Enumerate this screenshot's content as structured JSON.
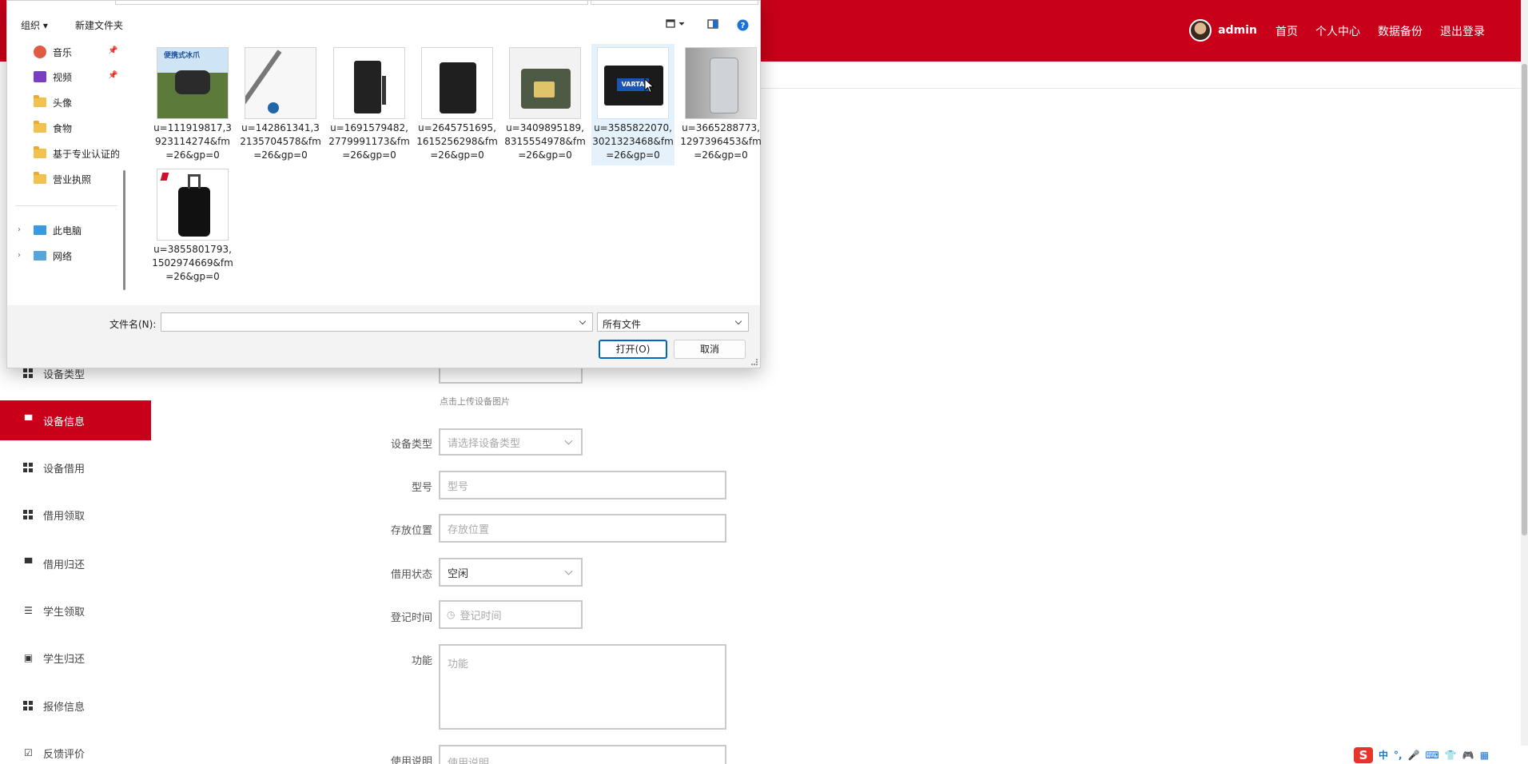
{
  "app": {
    "user_name": "admin",
    "nav": [
      "首页",
      "个人中心",
      "数据备份",
      "退出登录"
    ]
  },
  "sidebar": {
    "items": [
      {
        "label": "设备类型",
        "icon": "grid-icon",
        "active": false
      },
      {
        "label": "设备信息",
        "icon": "device-icon",
        "active": true
      },
      {
        "label": "设备借用",
        "icon": "grid-icon",
        "active": false
      },
      {
        "label": "借用领取",
        "icon": "grid-icon",
        "active": false
      },
      {
        "label": "借用归还",
        "icon": "device-icon",
        "active": false
      },
      {
        "label": "学生领取",
        "icon": "list-icon",
        "active": false
      },
      {
        "label": "学生归还",
        "icon": "clipboard-icon",
        "active": false
      },
      {
        "label": "报修信息",
        "icon": "grid-icon",
        "active": false
      },
      {
        "label": "反馈评价",
        "icon": "clipboard-check-icon",
        "active": false
      }
    ]
  },
  "form": {
    "upload_hint": "点击上传设备图片",
    "fields": {
      "type": {
        "label": "设备类型",
        "placeholder": "请选择设备类型"
      },
      "model": {
        "label": "型号",
        "placeholder": "型号"
      },
      "location": {
        "label": "存放位置",
        "placeholder": "存放位置"
      },
      "status": {
        "label": "借用状态",
        "value": "空闲"
      },
      "date": {
        "label": "登记时间",
        "placeholder": "登记时间"
      },
      "function": {
        "label": "功能",
        "placeholder": "功能"
      },
      "usage": {
        "label": "使用说明",
        "placeholder": "使用说明"
      }
    }
  },
  "dialog": {
    "toolbar": {
      "organize": "组织 ▾",
      "new_folder": "新建文件夹"
    },
    "nav_items": [
      "音乐",
      "视频",
      "头像",
      "食物",
      "基于专业认证的",
      "营业执照"
    ],
    "computer_items": [
      "此电脑",
      "网络"
    ],
    "files": [
      {
        "name": "u=111919817,3923114274&fm=26&gp=0",
        "selected": false
      },
      {
        "name": "u=142861341,32135704578&fm=26&gp=0",
        "selected": false
      },
      {
        "name": "u=1691579482,2779991173&fm=26&gp=0",
        "selected": false
      },
      {
        "name": "u=2645751695,1615256298&fm=26&gp=0",
        "selected": false
      },
      {
        "name": "u=3409895189,8315554978&fm=26&gp=0",
        "selected": false
      },
      {
        "name": "u=3585822070,3021323468&fm=26&gp=0",
        "selected": true
      },
      {
        "name": "u=3665288773,1297396453&fm=26&gp=0",
        "selected": false
      },
      {
        "name": "u=3855801793,1502974669&fm=26&gp=0",
        "selected": false
      }
    ],
    "thumb1_caption": "便携式冰爪",
    "thumb6_brand": "VARTA",
    "filename_label": "文件名(N):",
    "filename_value": "",
    "filetype": "所有文件",
    "open_label": "打开(O)",
    "cancel_label": "取消"
  },
  "tray": {
    "ime": "中",
    "symbols": "°,"
  },
  "colors": {
    "brand": "#c8001a",
    "selection": "#e5f1fb",
    "focus": "#0067c0"
  }
}
